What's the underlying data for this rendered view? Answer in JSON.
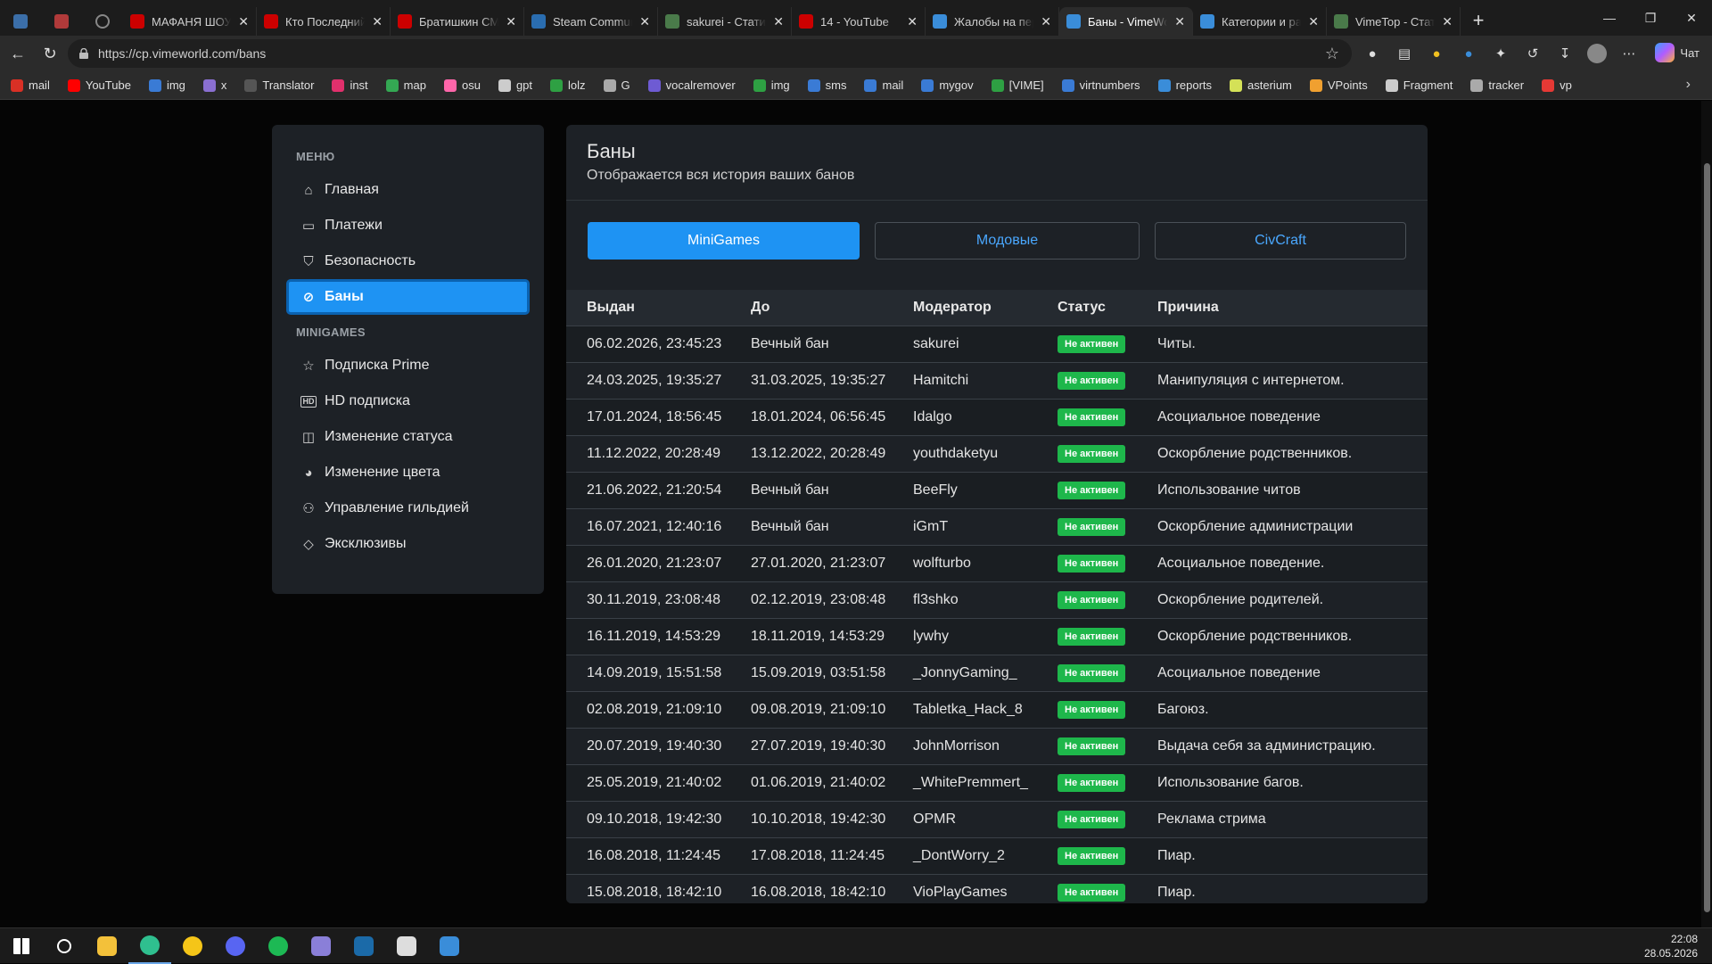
{
  "browser": {
    "tabs": [
      {
        "title": "",
        "color": "#3b6ea8",
        "pinned": true
      },
      {
        "title": "",
        "color": "#b03a3a",
        "pinned": true
      },
      {
        "title": "",
        "color": "#888888",
        "pinned": true,
        "icon": "globe-icon"
      },
      {
        "title": "МАФАНЯ ШОУ Н",
        "color": "#cc0000"
      },
      {
        "title": "Кто Последний В",
        "color": "#cc0000"
      },
      {
        "title": "Братишкин СМОТ",
        "color": "#cc0000"
      },
      {
        "title": "Steam Communit",
        "color": "#2a6db0"
      },
      {
        "title": "sakurei - Статисти",
        "color": "#4a7a4a"
      },
      {
        "title": "14 - YouTube",
        "color": "#cc0000"
      },
      {
        "title": "Жалобы на перс",
        "color": "#3a8dd9"
      },
      {
        "title": "Баны - VimeWorl",
        "color": "#3a8dd9",
        "active": true
      },
      {
        "title": "Категории и раз",
        "color": "#3a8dd9"
      },
      {
        "title": "VimeTop - Статис",
        "color": "#4a7a4a"
      }
    ],
    "url": "https://cp.vimeworld.com/bans",
    "copilot_label": "Чат",
    "bookmarks": [
      {
        "label": "mail",
        "color": "#d93025"
      },
      {
        "label": "YouTube",
        "color": "#ff0000"
      },
      {
        "label": "img",
        "color": "#3a7bd5"
      },
      {
        "label": "x",
        "color": "#8a6fd1"
      },
      {
        "label": "Translator",
        "color": "#555555"
      },
      {
        "label": "inst",
        "color": "#e1306c"
      },
      {
        "label": "map",
        "color": "#34a853"
      },
      {
        "label": "osu",
        "color": "#ff66aa"
      },
      {
        "label": "gpt",
        "color": "#cccccc"
      },
      {
        "label": "lolz",
        "color": "#2ea043"
      },
      {
        "label": "G",
        "color": "#aaaaaa"
      },
      {
        "label": "vocalremover",
        "color": "#6e5bd3"
      },
      {
        "label": "img",
        "color": "#2ea043"
      },
      {
        "label": "sms",
        "color": "#3a7bd5"
      },
      {
        "label": "mail",
        "color": "#3a7bd5"
      },
      {
        "label": "mygov",
        "color": "#3a7bd5"
      },
      {
        "label": "[VIME]",
        "color": "#2ea043"
      },
      {
        "label": "virtnumbers",
        "color": "#3a7bd5"
      },
      {
        "label": "reports",
        "color": "#3a8dd9"
      },
      {
        "label": "asterium",
        "color": "#d4e157"
      },
      {
        "label": "VPoints",
        "color": "#f0a030"
      },
      {
        "label": "Fragment",
        "color": "#cccccc"
      },
      {
        "label": "tracker",
        "color": "#aaaaaa"
      },
      {
        "label": "vp",
        "color": "#e53935"
      }
    ]
  },
  "sidebar": {
    "menu_heading": "МЕНЮ",
    "menu": [
      {
        "label": "Главная",
        "icon": "home-icon"
      },
      {
        "label": "Платежи",
        "icon": "credit-card-icon"
      },
      {
        "label": "Безопасность",
        "icon": "shield-icon"
      },
      {
        "label": "Баны",
        "icon": "ban-icon",
        "active": true
      }
    ],
    "minigames_heading": "MINIGAMES",
    "minigames": [
      {
        "label": "Подписка Prime",
        "icon": "star-icon"
      },
      {
        "label": "HD подписка",
        "icon": "hd-icon"
      },
      {
        "label": "Изменение статуса",
        "icon": "status-icon"
      },
      {
        "label": "Изменение цвета",
        "icon": "palette-icon"
      },
      {
        "label": "Управление гильдией",
        "icon": "users-icon"
      },
      {
        "label": "Эксклюзивы",
        "icon": "diamond-icon"
      }
    ]
  },
  "main": {
    "title": "Баны",
    "subtitle": "Отображается вся история ваших банов",
    "tabs": [
      "MiniGames",
      "Модовые",
      "CivCraft"
    ],
    "columns": [
      "Выдан",
      "До",
      "Модератор",
      "Статус",
      "Причина"
    ],
    "rows": [
      [
        "06.02.2026, 23:45:23",
        "Вечный бан",
        "sakurei",
        "Не активен",
        "Читы."
      ],
      [
        "24.03.2025, 19:35:27",
        "31.03.2025, 19:35:27",
        "Hamitchi",
        "Не активен",
        "Манипуляция с интернетом."
      ],
      [
        "17.01.2024, 18:56:45",
        "18.01.2024, 06:56:45",
        "Idalgo",
        "Не активен",
        "Асоциальное поведение"
      ],
      [
        "11.12.2022, 20:28:49",
        "13.12.2022, 20:28:49",
        "youthdaketyu",
        "Не активен",
        "Оскорбление родственников."
      ],
      [
        "21.06.2022, 21:20:54",
        "Вечный бан",
        "BeeFly",
        "Не активен",
        "Использование читов"
      ],
      [
        "16.07.2021, 12:40:16",
        "Вечный бан",
        "iGmT",
        "Не активен",
        "Оскорбление администрации"
      ],
      [
        "26.01.2020, 21:23:07",
        "27.01.2020, 21:23:07",
        "wolfturbo",
        "Не активен",
        "Асоциальное поведение."
      ],
      [
        "30.11.2019, 23:08:48",
        "02.12.2019, 23:08:48",
        "fl3shko",
        "Не активен",
        "Оскорбление родителей."
      ],
      [
        "16.11.2019, 14:53:29",
        "18.11.2019, 14:53:29",
        "lywhy",
        "Не активен",
        "Оскорбление родственников."
      ],
      [
        "14.09.2019, 15:51:58",
        "15.09.2019, 03:51:58",
        "_JonnyGaming_",
        "Не активен",
        "Асоциальное поведение"
      ],
      [
        "02.08.2019, 21:09:10",
        "09.08.2019, 21:09:10",
        "Tabletka_Hack_8",
        "Не активен",
        "Багоюз."
      ],
      [
        "20.07.2019, 19:40:30",
        "27.07.2019, 19:40:30",
        "JohnMorrison",
        "Не активен",
        "Выдача себя за администрацию."
      ],
      [
        "25.05.2019, 21:40:02",
        "01.06.2019, 21:40:02",
        "_WhitePremmert_",
        "Не активен",
        "Использование багов."
      ],
      [
        "09.10.2018, 19:42:30",
        "10.10.2018, 19:42:30",
        "OPMR",
        "Не активен",
        "Реклама стрима"
      ],
      [
        "16.08.2018, 11:24:45",
        "17.08.2018, 11:24:45",
        "_DontWorry_2",
        "Не активен",
        "Пиар."
      ],
      [
        "15.08.2018, 18:42:10",
        "16.08.2018, 18:42:10",
        "VioPlayGames",
        "Не активен",
        "Пиар."
      ]
    ]
  },
  "taskbar": {
    "apps": [
      {
        "name": "windows-start-icon",
        "color": "#ffffff"
      },
      {
        "name": "search-icon",
        "color": "#ffffff"
      },
      {
        "name": "file-explorer-icon",
        "color": "#f3c13a"
      },
      {
        "name": "edge-icon",
        "color": "#2fbf8f",
        "open": true
      },
      {
        "name": "messenger-icon",
        "color": "#f5c518"
      },
      {
        "name": "discord-icon",
        "color": "#5865f2"
      },
      {
        "name": "spotify-icon",
        "color": "#1db954"
      },
      {
        "name": "app-icon",
        "color": "#8a7fd8"
      },
      {
        "name": "steam-icon",
        "color": "#1b6aa8"
      },
      {
        "name": "mouse-app-icon",
        "color": "#dddddd"
      },
      {
        "name": "vimeworld-icon",
        "color": "#3a8dd9"
      }
    ],
    "time": "22:08",
    "date": "28.05.2026"
  }
}
